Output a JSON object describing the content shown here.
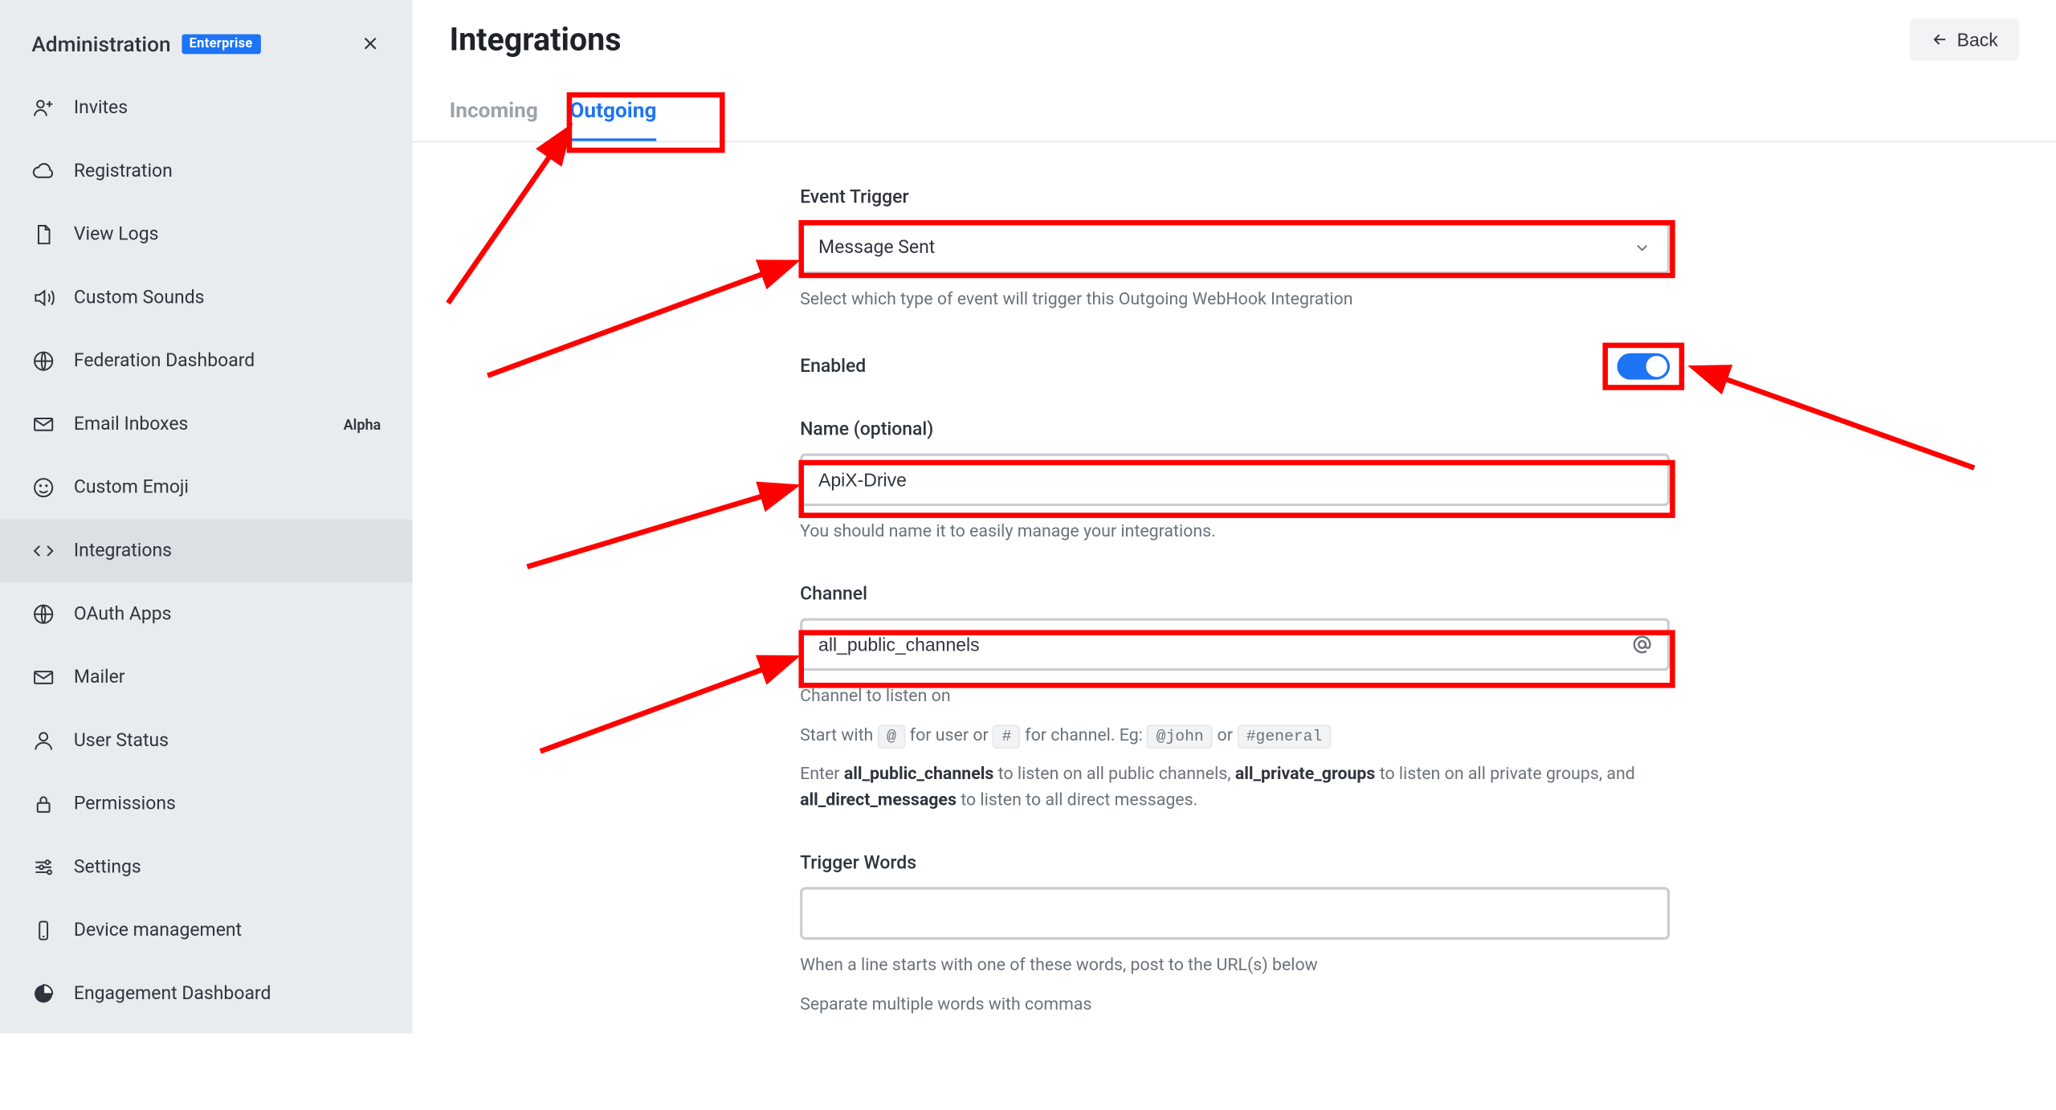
{
  "sidebar": {
    "title": "Administration",
    "badge": "Enterprise",
    "items": [
      {
        "label": "Invites",
        "icon": "user-plus"
      },
      {
        "label": "Registration",
        "icon": "cloud"
      },
      {
        "label": "View Logs",
        "icon": "document"
      },
      {
        "label": "Custom Sounds",
        "icon": "sound"
      },
      {
        "label": "Federation Dashboard",
        "icon": "globe"
      },
      {
        "label": "Email Inboxes",
        "icon": "mail",
        "tag": "Alpha"
      },
      {
        "label": "Custom Emoji",
        "icon": "emoji"
      },
      {
        "label": "Integrations",
        "icon": "code",
        "active": true
      },
      {
        "label": "OAuth Apps",
        "icon": "globe"
      },
      {
        "label": "Mailer",
        "icon": "mail"
      },
      {
        "label": "User Status",
        "icon": "user"
      },
      {
        "label": "Permissions",
        "icon": "lock"
      },
      {
        "label": "Settings",
        "icon": "settings"
      },
      {
        "label": "Device management",
        "icon": "device"
      },
      {
        "label": "Engagement Dashboard",
        "icon": "pie"
      }
    ]
  },
  "header": {
    "title": "Integrations",
    "back": "Back"
  },
  "tabs": {
    "incoming": "Incoming",
    "outgoing": "Outgoing"
  },
  "form": {
    "event_trigger": {
      "label": "Event Trigger",
      "value": "Message Sent",
      "help": "Select which type of event will trigger this Outgoing WebHook Integration"
    },
    "enabled": {
      "label": "Enabled",
      "value": true
    },
    "name": {
      "label": "Name (optional)",
      "value": "ApiX-Drive",
      "help": "You should name it to easily manage your integrations."
    },
    "channel": {
      "label": "Channel",
      "value": "all_public_channels",
      "help1": "Channel to listen on",
      "help2_pre": "Start with ",
      "help2_at": "@",
      "help2_mid1": " for user or ",
      "help2_hash": "#",
      "help2_mid2": " for channel. Eg: ",
      "help2_john": "@john",
      "help2_or": " or ",
      "help2_gen": "#general",
      "help3_pre": "Enter ",
      "help3_apc": "all_public_channels",
      "help3_mid1": " to listen on all public channels, ",
      "help3_apg": "all_private_groups",
      "help3_mid2": " to listen on all private groups, and ",
      "help3_adm": "all_direct_messages",
      "help3_end": " to listen to all direct messages."
    },
    "trigger_words": {
      "label": "Trigger Words",
      "value": "",
      "help1": "When a line starts with one of these words, post to the URL(s) below",
      "help2": "Separate multiple words with commas"
    }
  }
}
